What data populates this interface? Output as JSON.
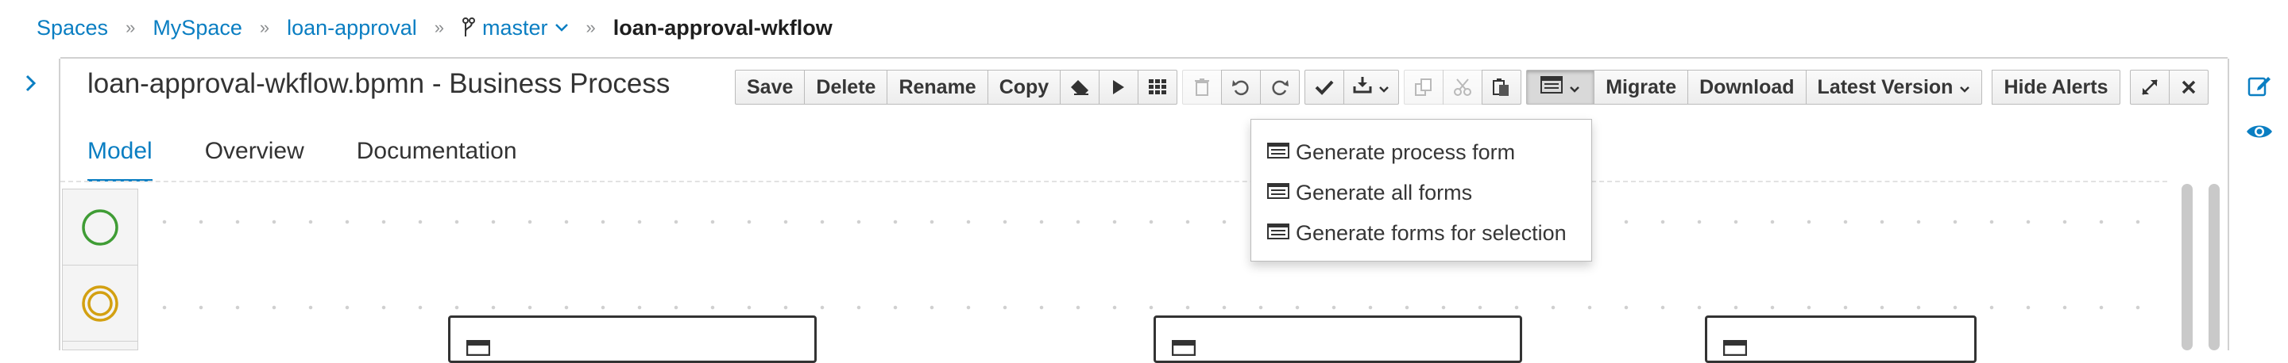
{
  "breadcrumb": {
    "spaces": "Spaces",
    "space": "MySpace",
    "project": "loan-approval",
    "branch": "master",
    "current": "loan-approval-wkflow",
    "separator": "»"
  },
  "editor": {
    "title": "loan-approval-wkflow.bpmn - Business Process"
  },
  "toolbar": {
    "save": "Save",
    "delete": "Delete",
    "rename": "Rename",
    "copy": "Copy",
    "migrate": "Migrate",
    "download": "Download",
    "latest_version": "Latest Version",
    "hide_alerts": "Hide Alerts",
    "icons": [
      "eraser-icon",
      "play-icon",
      "grid-icon",
      "trash-icon",
      "undo-icon",
      "redo-icon",
      "check-icon",
      "download-icon",
      "duplicate-icon",
      "cut-icon",
      "paste-icon",
      "form-icon",
      "expand-icon",
      "close-icon"
    ]
  },
  "tabs": [
    "Model",
    "Overview",
    "Documentation"
  ],
  "active_tab": "Model",
  "form_menu": {
    "items": [
      "Generate process form",
      "Generate all forms",
      "Generate forms for selection"
    ]
  },
  "palette": {
    "items": [
      "start-event-icon",
      "intermediate-event-icon"
    ]
  },
  "colors": {
    "link": "#0a7ec2",
    "start_event": "#3f9c35",
    "intermediate_event": "#d3a011"
  }
}
